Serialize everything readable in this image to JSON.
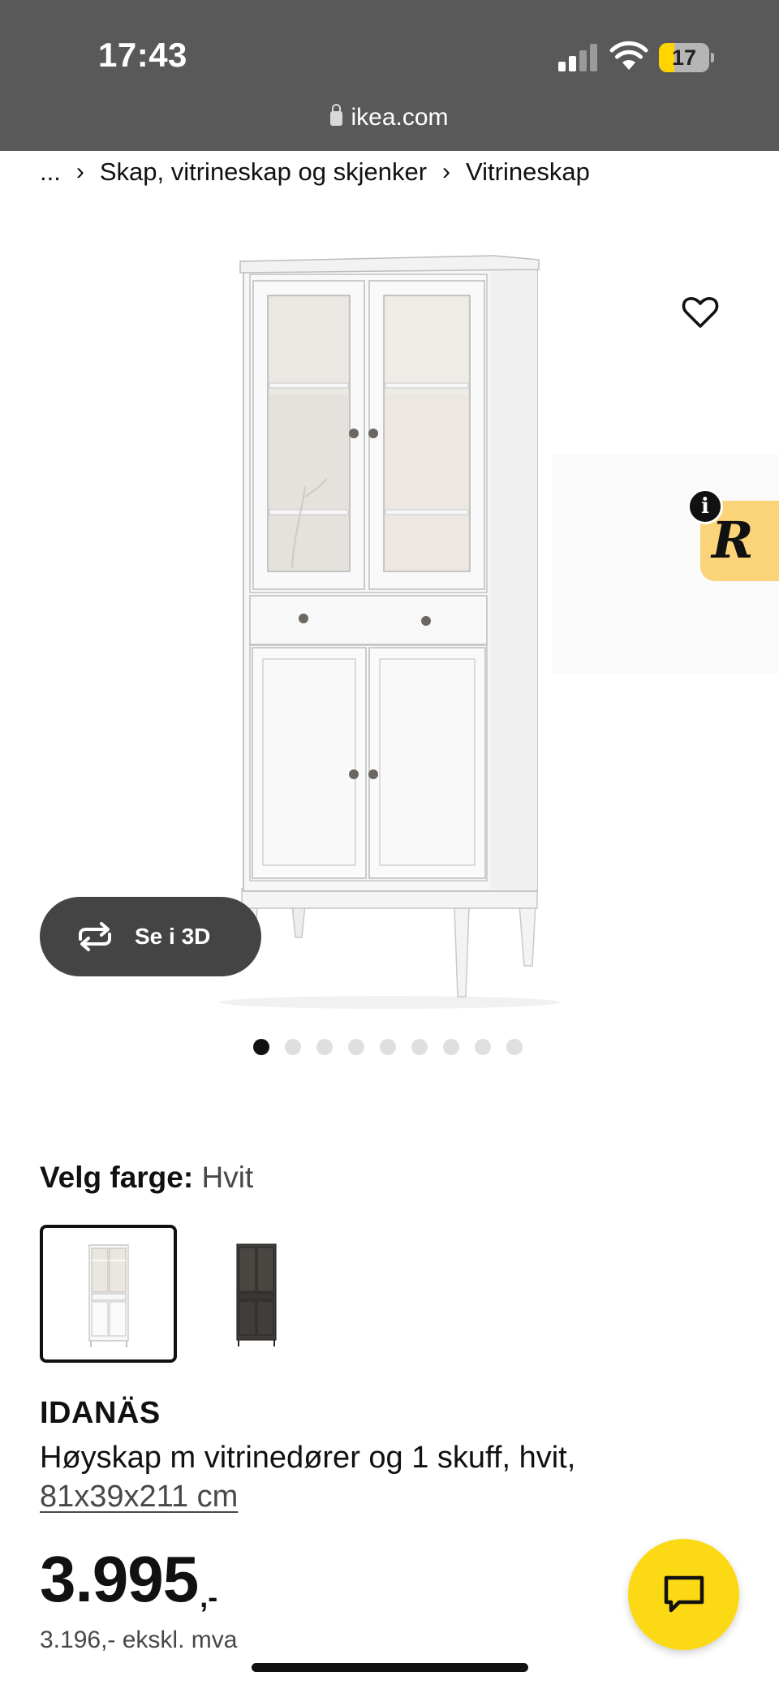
{
  "status_bar": {
    "time": "17:43",
    "battery_level": "17",
    "battery_fraction": 0.17,
    "battery_color": "#ffd400"
  },
  "browser": {
    "url": "ikea.com",
    "lock_icon": "lock-icon"
  },
  "breadcrumb": {
    "ellipsis": "...",
    "separator": "›",
    "items": [
      "Skap, vitrineskap og skjenker",
      "Vitrineskap"
    ]
  },
  "gallery": {
    "favorite_icon": "heart-outline-icon",
    "view_3d_label": "Se i 3D",
    "view_3d_icon": "rotate-arrows-icon",
    "image_count": 9,
    "active_image_index": 0,
    "widget_letter": "R",
    "widget_info": "i",
    "widget_color": "#fbd479"
  },
  "color_selection": {
    "label": "Velg farge:",
    "selected_value": "Hvit",
    "options": [
      "Hvit",
      "Mørkegrå"
    ]
  },
  "product": {
    "name": "IDANÄS",
    "description": "Høyskap m vitrinedører og 1 skuff, hvit,",
    "dimensions": "81x39x211 cm",
    "price": "3.995",
    "price_suffix": ",-",
    "price_ex_vat": "3.196,- ekskl. mva"
  },
  "chat": {
    "icon": "chat-bubble-icon",
    "color": "#fbd914"
  }
}
